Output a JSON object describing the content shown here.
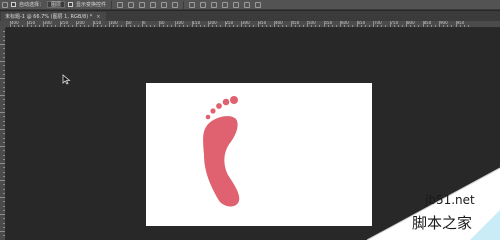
{
  "options_bar": {
    "auto_select_label": "自动选择：",
    "layer_select_value": "图层",
    "transform_label": "显示变换控件"
  },
  "document": {
    "tab_label": "未标题-1 @ 66.7% (图层 1, RGB/8) *",
    "close_glyph": "×"
  },
  "ruler": {
    "top_labels": [
      "400",
      "350",
      "300",
      "250",
      "200",
      "150",
      "100",
      "50",
      "0",
      "50",
      "100",
      "150",
      "200",
      "250",
      "300",
      "350",
      "400",
      "450",
      "500",
      "550",
      "600",
      "650",
      "700",
      "750",
      "800",
      "850",
      "900",
      "950"
    ],
    "left_labels": [
      "100",
      "50",
      "0",
      "50",
      "100",
      "150",
      "200",
      "250",
      "300",
      "350",
      "400",
      "450",
      "500"
    ]
  },
  "canvas": {
    "background": "#ffffff",
    "shape_color": "#e0616f",
    "shape": "footprint"
  },
  "watermark": {
    "site": "jb51.net",
    "name": "脚本之家"
  }
}
